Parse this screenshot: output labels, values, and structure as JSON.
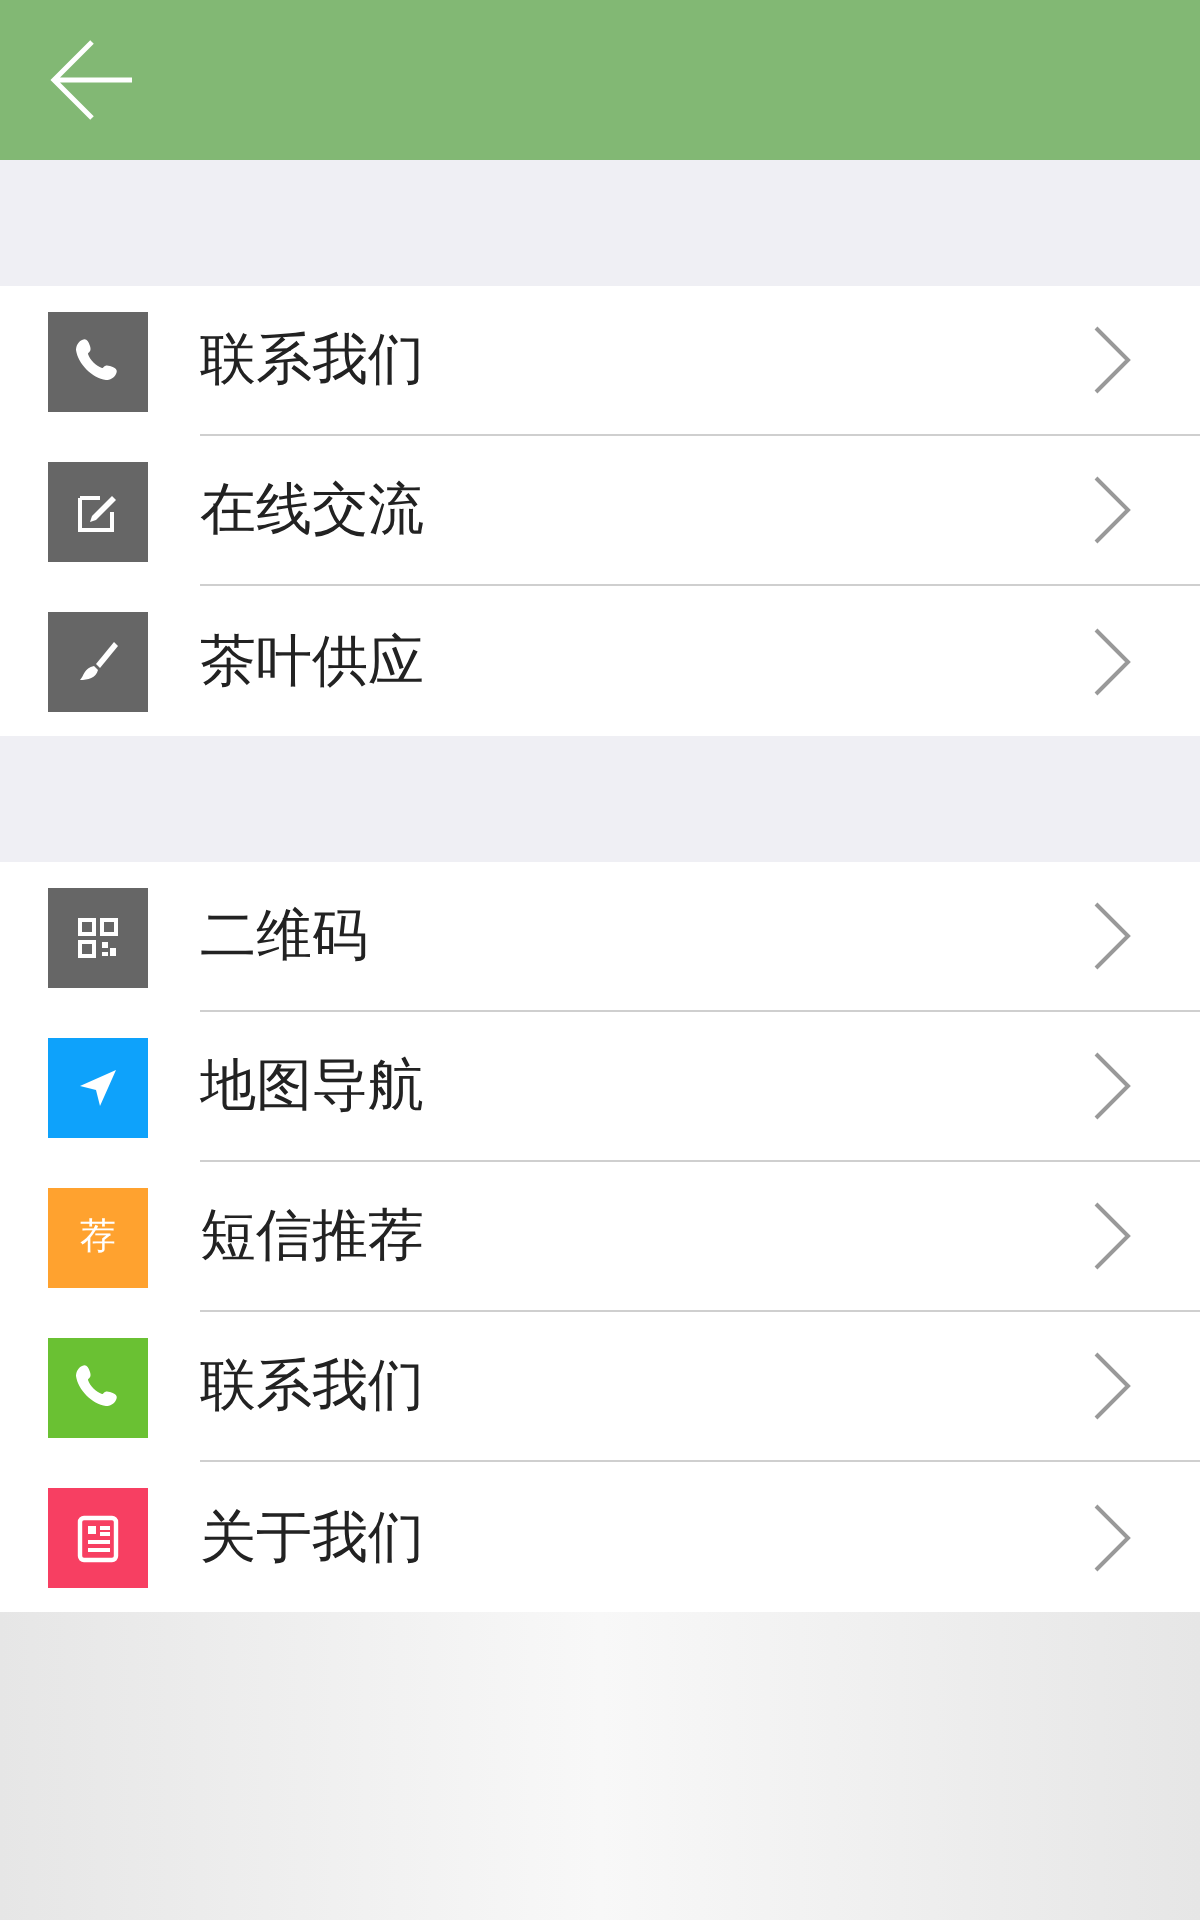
{
  "groups": [
    {
      "items": [
        {
          "label": "联系我们",
          "kind": "phone",
          "color": "#666666"
        },
        {
          "label": "在线交流",
          "kind": "edit",
          "color": "#666666"
        },
        {
          "label": "茶叶供应",
          "kind": "brush",
          "color": "#666666"
        }
      ]
    },
    {
      "items": [
        {
          "label": "二维码",
          "kind": "qr",
          "color": "#666666"
        },
        {
          "label": "地图导航",
          "kind": "navigate",
          "color": "#0ea2fb"
        },
        {
          "label": "短信推荐",
          "kind": "glyph",
          "icon_text": "荐",
          "color": "#ffa22f"
        },
        {
          "label": "联系我们",
          "kind": "phone",
          "color": "#6ac133"
        },
        {
          "label": "关于我们",
          "kind": "document",
          "color": "#f73f62"
        }
      ]
    }
  ]
}
